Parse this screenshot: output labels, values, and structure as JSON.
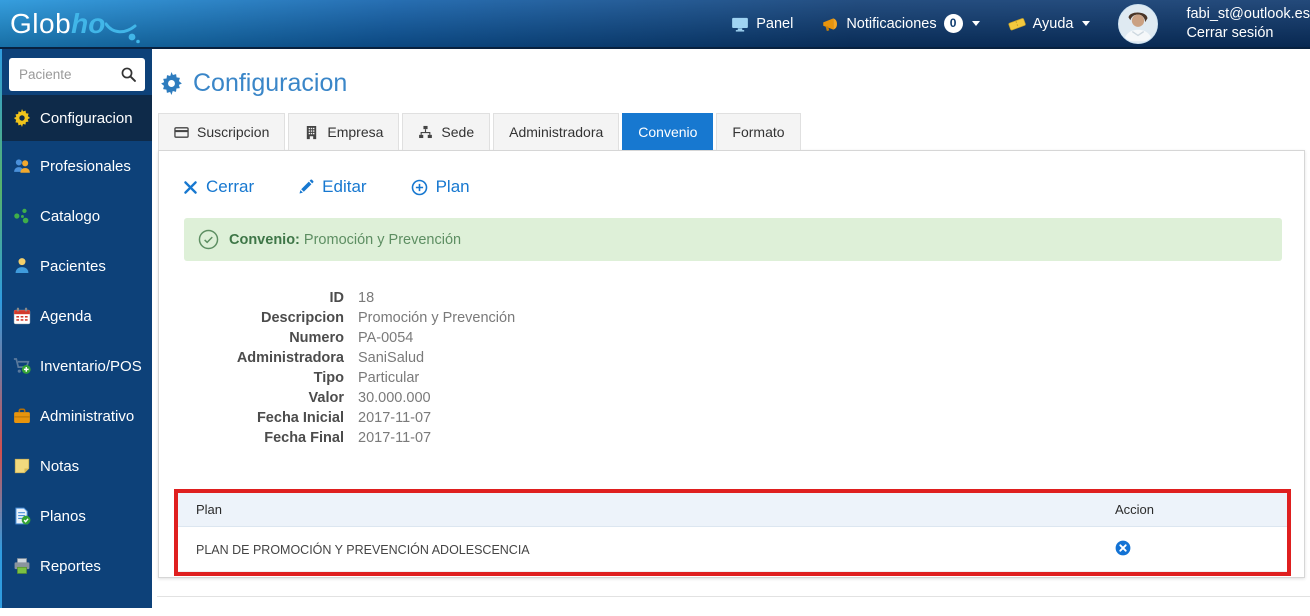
{
  "topbar": {
    "logo": {
      "part1": "Glob",
      "part2": "ho"
    },
    "nav": {
      "panel": {
        "label": "Panel",
        "icon": "monitor-icon"
      },
      "notifications": {
        "label": "Notificaciones",
        "badge": "0",
        "icon": "horn-icon"
      },
      "help": {
        "label": "Ayuda",
        "icon": "ticket-icon"
      }
    },
    "user": {
      "email": "fabi_st@outlook.es",
      "logout": "Cerrar sesión",
      "icon": "avatar"
    }
  },
  "sidebar": {
    "search": {
      "placeholder": "Paciente",
      "icon": "search-icon"
    },
    "items": [
      {
        "label": "Configuracion",
        "icon": "gear-icon",
        "active": true
      },
      {
        "label": "Profesionales",
        "icon": "people-icon"
      },
      {
        "label": "Catalogo",
        "icon": "nodes-icon"
      },
      {
        "label": "Pacientes",
        "icon": "person-icon"
      },
      {
        "label": "Agenda",
        "icon": "calendar-icon"
      },
      {
        "label": "Inventario/POS",
        "icon": "cart-plus-icon"
      },
      {
        "label": "Administrativo",
        "icon": "briefcase-icon"
      },
      {
        "label": "Notas",
        "icon": "sticky-note-icon"
      },
      {
        "label": "Planos",
        "icon": "document-check-icon"
      },
      {
        "label": "Reportes",
        "icon": "printer-icon"
      }
    ]
  },
  "main": {
    "title": "Configuracion",
    "title_icon": "gear-icon",
    "tabs": [
      {
        "label": "Suscripcion",
        "icon": "credit-card-icon"
      },
      {
        "label": "Empresa",
        "icon": "building-icon"
      },
      {
        "label": "Sede",
        "icon": "sitemap-icon"
      },
      {
        "label": "Administradora"
      },
      {
        "label": "Convenio",
        "active": true
      },
      {
        "label": "Formato"
      }
    ],
    "actions": [
      {
        "label": "Cerrar",
        "icon": "close-icon"
      },
      {
        "label": "Editar",
        "icon": "pencil-icon"
      },
      {
        "label": "Plan",
        "icon": "plus-circle-icon"
      }
    ],
    "alert": {
      "icon": "check-circle-icon",
      "title": "Convenio:",
      "text": "Promoción y Prevención"
    },
    "details": [
      {
        "label": "ID",
        "value": "18"
      },
      {
        "label": "Descripcion",
        "value": "Promoción y Prevención"
      },
      {
        "label": "Numero",
        "value": "PA-0054"
      },
      {
        "label": "Administradora",
        "value": "SaniSalud"
      },
      {
        "label": "Tipo",
        "value": "Particular"
      },
      {
        "label": "Valor",
        "value": "30.000.000"
      },
      {
        "label": "Fecha Inicial",
        "value": "2017-11-07"
      },
      {
        "label": "Fecha Final",
        "value": "2017-11-07"
      }
    ],
    "table": {
      "headers": {
        "plan": "Plan",
        "action": "Accion"
      },
      "rows": [
        {
          "plan": "PLAN DE PROMOCIÓN Y PREVENCIÓN ADOLESCENCIA",
          "action_icon": "delete-circle-icon"
        }
      ]
    }
  },
  "colors": {
    "accent_blue": "#1778d0",
    "topbar_dark": "#0b356b",
    "sidebar_navy": "#0d4179",
    "sidebar_active": "#0e2a49",
    "alert_bg": "#def0d8",
    "alert_text": "#3e7647",
    "highlight_red": "#df1f1f",
    "table_header_bg": "#edf3fa",
    "title_blue": "#3a86c8"
  }
}
